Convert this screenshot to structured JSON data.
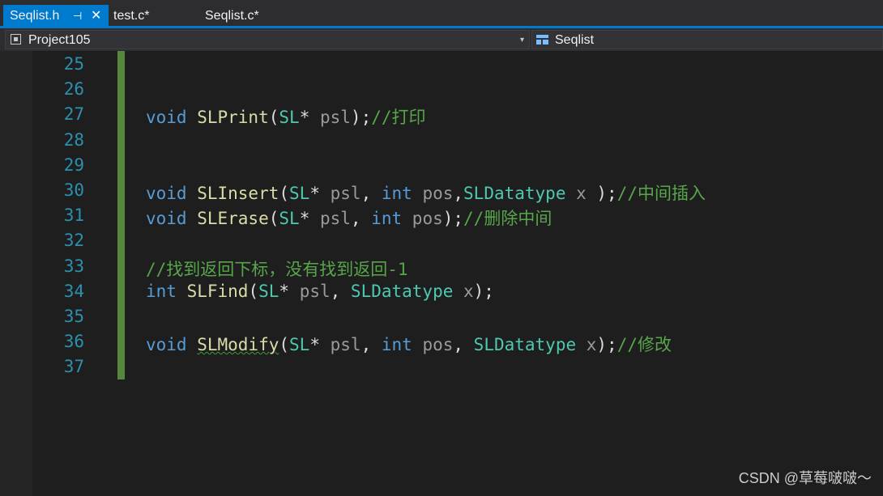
{
  "tabs": [
    {
      "label": "Seqlist.h",
      "pin": "⊣",
      "close": "✕"
    },
    {
      "label": "test.c*"
    },
    {
      "label": "Seqlist.c*"
    }
  ],
  "nav": {
    "project": "Project105",
    "scope": "Seqlist",
    "dropdown_glyph": "▾"
  },
  "lines": [
    {
      "n": "25",
      "parts": []
    },
    {
      "n": "26",
      "parts": []
    },
    {
      "n": "27",
      "parts": [
        [
          "kw",
          "void "
        ],
        [
          "fn",
          "SLPrint"
        ],
        [
          "pl",
          "("
        ],
        [
          "ty",
          "SL"
        ],
        [
          "pl",
          "* "
        ],
        [
          "pr",
          "psl"
        ],
        [
          "pl",
          ");"
        ],
        [
          "cm",
          "//打印"
        ]
      ]
    },
    {
      "n": "28",
      "parts": []
    },
    {
      "n": "29",
      "parts": []
    },
    {
      "n": "30",
      "parts": [
        [
          "kw",
          "void "
        ],
        [
          "fn",
          "SLInsert"
        ],
        [
          "pl",
          "("
        ],
        [
          "ty",
          "SL"
        ],
        [
          "pl",
          "* "
        ],
        [
          "pr",
          "psl"
        ],
        [
          "pl",
          ", "
        ],
        [
          "kw",
          "int "
        ],
        [
          "pr",
          "pos"
        ],
        [
          "pl",
          ","
        ],
        [
          "ty",
          "SLDatatype "
        ],
        [
          "pr",
          "x "
        ],
        [
          "pl",
          ");"
        ],
        [
          "cm",
          "//中间插入"
        ]
      ]
    },
    {
      "n": "31",
      "parts": [
        [
          "kw",
          "void "
        ],
        [
          "fn",
          "SLErase"
        ],
        [
          "pl",
          "("
        ],
        [
          "ty",
          "SL"
        ],
        [
          "pl",
          "* "
        ],
        [
          "pr",
          "psl"
        ],
        [
          "pl",
          ", "
        ],
        [
          "kw",
          "int "
        ],
        [
          "pr",
          "pos"
        ],
        [
          "pl",
          ");"
        ],
        [
          "cm",
          "//删除中间"
        ]
      ]
    },
    {
      "n": "32",
      "parts": []
    },
    {
      "n": "33",
      "parts": [
        [
          "cm",
          "//找到返回下标，没有找到返回-1"
        ]
      ]
    },
    {
      "n": "34",
      "parts": [
        [
          "kw",
          "int "
        ],
        [
          "fn",
          "SLFind"
        ],
        [
          "pl",
          "("
        ],
        [
          "ty",
          "SL"
        ],
        [
          "pl",
          "* "
        ],
        [
          "pr",
          "psl"
        ],
        [
          "pl",
          ", "
        ],
        [
          "ty",
          "SLDatatype "
        ],
        [
          "pr",
          "x"
        ],
        [
          "pl",
          ");"
        ]
      ]
    },
    {
      "n": "35",
      "parts": []
    },
    {
      "n": "36",
      "parts": [
        [
          "kw",
          "void "
        ],
        [
          "fnsq",
          "SLModify"
        ],
        [
          "pl",
          "("
        ],
        [
          "ty",
          "SL"
        ],
        [
          "pl",
          "* "
        ],
        [
          "pr",
          "psl"
        ],
        [
          "pl",
          ", "
        ],
        [
          "kw",
          "int "
        ],
        [
          "pr",
          "pos"
        ],
        [
          "pl",
          ", "
        ],
        [
          "ty",
          "SLDatatype "
        ],
        [
          "pr",
          "x"
        ],
        [
          "pl",
          ");"
        ],
        [
          "cm",
          "//修改"
        ]
      ]
    },
    {
      "n": "37",
      "parts": []
    }
  ],
  "colors": {
    "accent": "#007acc",
    "keyword": "#569cd6",
    "function": "#dcdcaa",
    "type": "#4ec9b0",
    "comment": "#57a64a",
    "line_number": "#2b91af",
    "change_bar": "#57863d"
  },
  "icons": {
    "project": "project-icon",
    "scope": "class-icon",
    "pin": "pin-icon",
    "close": "close-icon"
  },
  "watermark": "CSDN @草莓啵啵～"
}
